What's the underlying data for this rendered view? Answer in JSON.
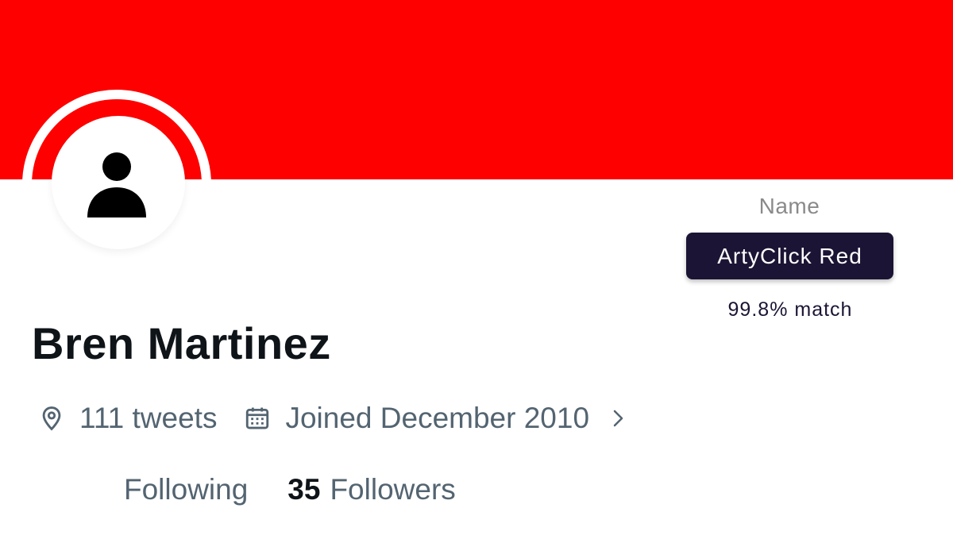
{
  "colors": {
    "banner": "#ff0000",
    "color_pill": "#1c1434",
    "secondary_text": "#536471",
    "primary_text": "#0f1419"
  },
  "color_match": {
    "label": "Name",
    "color_name": "ArtyClick Red",
    "match": "99.8% match"
  },
  "profile": {
    "avatar_icon": "person-icon",
    "display_name": "Bren Martinez",
    "meta": {
      "location_icon": "location-pin-icon",
      "tweets": "111 tweets",
      "calendar_icon": "calendar-icon",
      "joined": "Joined December 2010",
      "chevron_icon": "chevron-right-icon"
    },
    "following_label": "Following",
    "followers_count": "35",
    "followers_label": "Followers"
  }
}
